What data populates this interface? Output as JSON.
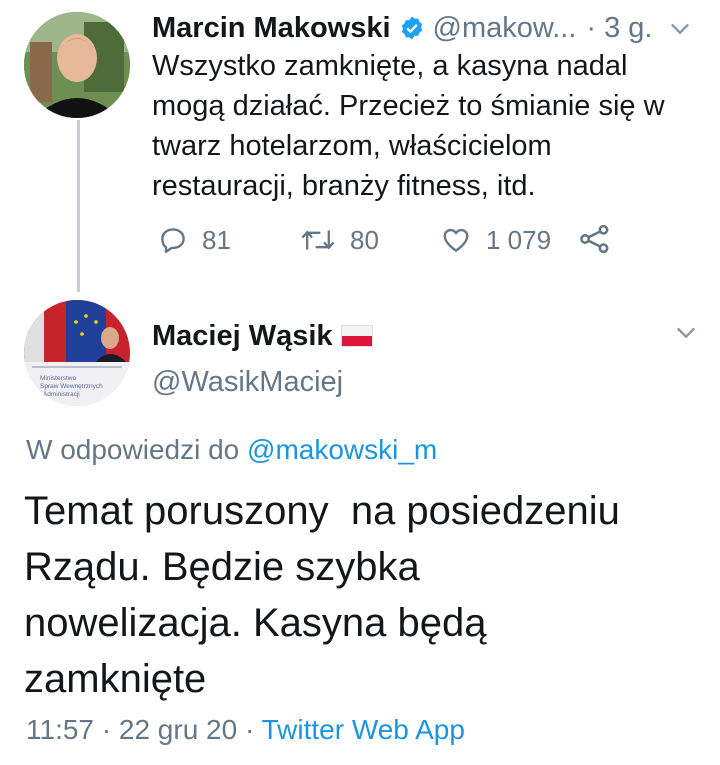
{
  "parent_tweet": {
    "author_name": "Marcin Makowski",
    "handle": "@makow...",
    "time": "· 3 g.",
    "text_lines": [
      "Wszystko zamknięte, a kasyna nadal",
      "mogą działać. Przecież to śmianie się w",
      "twarz hotelarzom, właścicielom",
      "restauracji, branży fitness, itd."
    ],
    "replies": "81",
    "retweets": "80",
    "likes": "1 079",
    "colors": {
      "verified": "#1da1f2",
      "muted": "#657786"
    }
  },
  "main_tweet": {
    "author_name": "Maciej Wąsik",
    "handle": "@WasikMaciej",
    "flag": "poland-flag",
    "reply_prefix": "W odpowiedzi do",
    "reply_to": "@makowski_m",
    "text_lines": [
      "Temat poruszony  na posiedzeniu",
      "Rządu. Będzie szybka",
      "nowelizacja. Kasyna będą",
      "zamknięte"
    ],
    "avatar_caption": [
      "Ministerstwo",
      "Spraw Wewnętrznych",
      "i Administracji"
    ],
    "timestamp": "11:57 · 22 gru 20 ·",
    "source": "Twitter Web App",
    "colors": {
      "link": "#1b95e0"
    }
  }
}
